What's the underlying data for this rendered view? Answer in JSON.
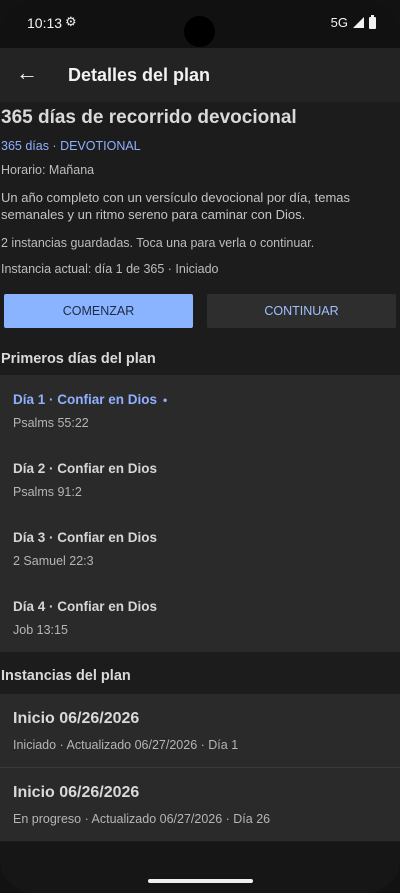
{
  "status": {
    "time": "10:13",
    "network": "5G"
  },
  "appbar": {
    "title": "Detalles del plan"
  },
  "plan": {
    "title": "365 días de recorrido devocional",
    "meta": "365 días · DEVOTIONAL",
    "schedule": "Horario: Mañana",
    "description": "Un año completo con un versículo devocional por día, temas semanales y un ritmo sereno para caminar con Dios.",
    "instances_note": "2 instancias guardadas. Toca una para verla o continuar.",
    "current_instance": "Instancia actual: día 1 de 365 · Iniciado"
  },
  "actions": {
    "start_label": "COMENZAR",
    "continue_label": "CONTINUAR"
  },
  "days_section": {
    "title": "Primeros días del plan",
    "items": [
      {
        "title": "Día 1 · Confiar en Dios",
        "ref": "Psalms 55:22",
        "current": true
      },
      {
        "title": "Día 2 · Confiar en Dios",
        "ref": "Psalms 91:2"
      },
      {
        "title": "Día 3 · Confiar en Dios",
        "ref": "2 Samuel 22:3"
      },
      {
        "title": "Día 4 · Confiar en Dios",
        "ref": "Job 13:15"
      }
    ]
  },
  "instances_section": {
    "title": "Instancias del plan",
    "items": [
      {
        "title": "Inicio 06/26/2026",
        "subtitle": "Iniciado · Actualizado 06/27/2026 · Día 1"
      },
      {
        "title": "Inicio 06/26/2026",
        "subtitle": "En progreso · Actualizado 06/27/2026 · Día 26"
      }
    ]
  },
  "colors": {
    "accent": "#8ab4ff",
    "background": "#1c1c1c",
    "surface": "#2a2a2a"
  },
  "icons": {
    "back": "arrow-left-icon",
    "settings": "gear-icon",
    "signal": "signal-icon",
    "battery": "battery-icon"
  }
}
